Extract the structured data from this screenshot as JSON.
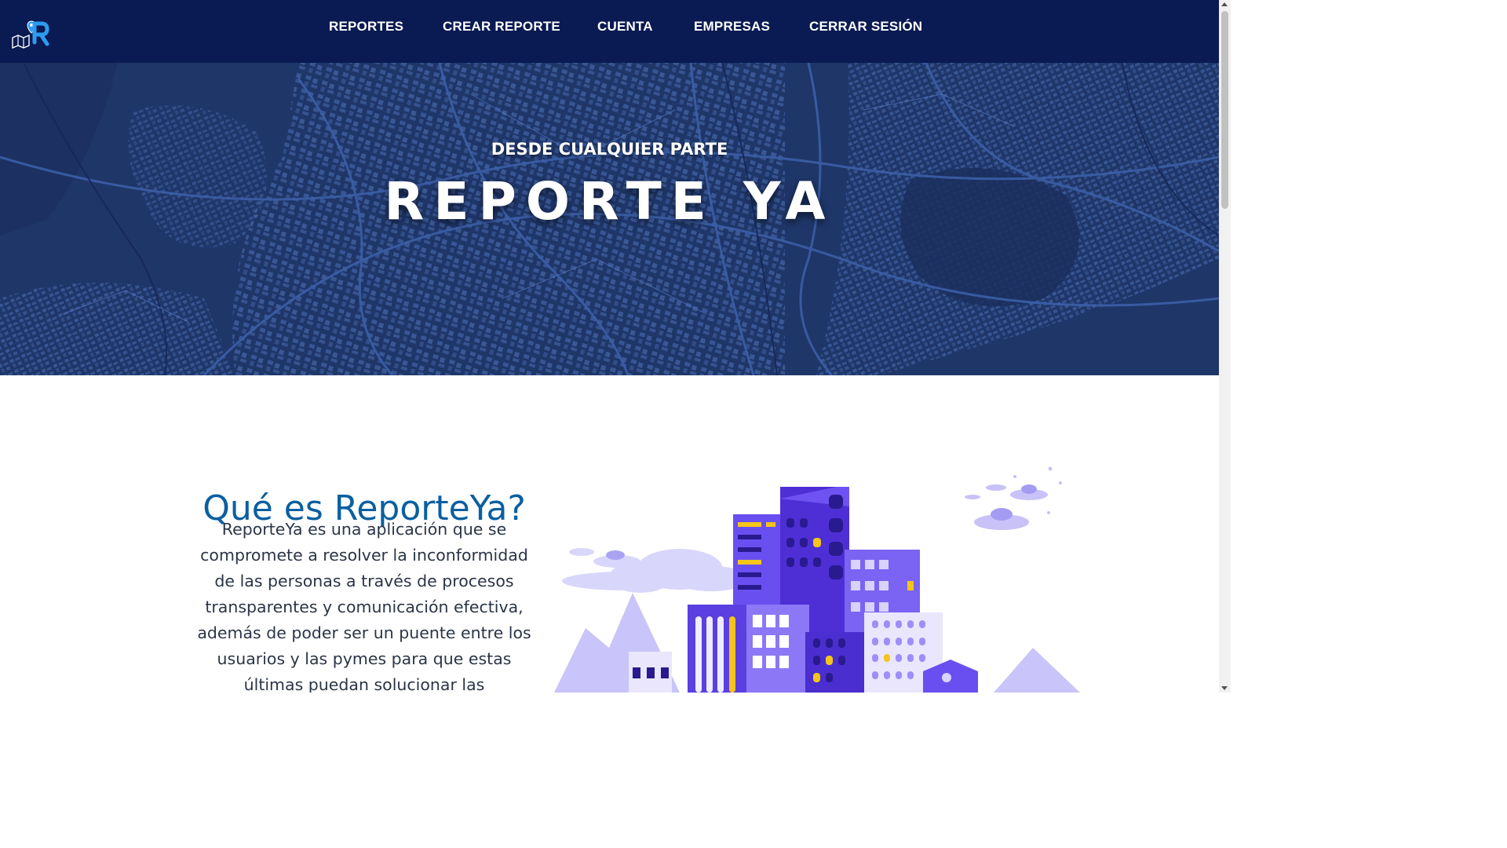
{
  "nav": {
    "items": [
      {
        "label": "REPORTES"
      },
      {
        "label": "CREAR REPORTE"
      },
      {
        "label": "CUENTA"
      },
      {
        "label": "EMPRESAS"
      },
      {
        "label": "CERRAR SESIÓN"
      }
    ]
  },
  "hero": {
    "subtitle": "DESDE CUALQUIER PARTE",
    "title": "REPORTE YA"
  },
  "about": {
    "title": "Qué es ReporteYa?",
    "text": "ReporteYa es una aplicación que se compromete a resolver la inconformidad de las personas a través de procesos transparentes y comunicación efectiva, además de poder ser un puente entre los usuarios y las pymes para que estas últimas puedan solucionar las necesidades"
  },
  "icons": {
    "logo": "reporteya-logo-icon"
  },
  "colors": {
    "navbar": "#0a1a52",
    "hero_bg": "#1e3566",
    "title_blue": "#0b5fa0",
    "text": "#2b3547",
    "building_purple": "#5b3fe0",
    "accent_yellow": "#f5c518"
  }
}
